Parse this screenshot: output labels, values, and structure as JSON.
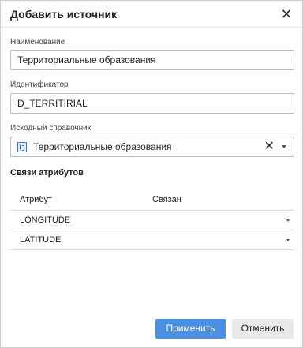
{
  "dialog": {
    "title": "Добавить источник",
    "close_symbol": "✕"
  },
  "fields": {
    "name": {
      "label": "Наименование",
      "value": "Территориальные образования"
    },
    "identifier": {
      "label": "Идентификатор",
      "value": "D_TERRITIRIAL"
    },
    "source_dictionary": {
      "label": "Исходный справочник",
      "value": "Территориальные образования",
      "icon": "dictionary-icon",
      "clear_symbol": "✕"
    }
  },
  "attributes": {
    "section_title": "Связи атрибутов",
    "columns": [
      "Атрибут",
      "Связан"
    ],
    "rows": [
      {
        "attribute": "LONGITUDE",
        "linked": ""
      },
      {
        "attribute": "LATITUDE",
        "linked": ""
      }
    ]
  },
  "actions": {
    "apply_label": "Применить",
    "cancel_label": "Отменить"
  },
  "colors": {
    "primary": "#4a90e2",
    "secondary": "#e9e9e9",
    "icon": "#3b77c6"
  }
}
